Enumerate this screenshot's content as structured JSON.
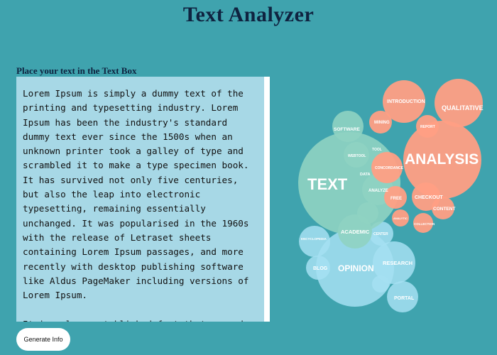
{
  "header": {
    "title": "Text Analyzer"
  },
  "input": {
    "label": "Place your text in the Text Box",
    "value": "Lorem Ipsum is simply a dummy text of the printing and typesetting industry. Lorem Ipsum has been the industry's standard dummy text ever since the 1500s when an unknown printer took a galley of type and scrambled it to make a type specimen book. It has survived not only five centuries, but also the leap into electronic typesetting, remaining essentially unchanged. It was popularised in the 1960s with the release of Letraset sheets containing Lorem Ipsum passages, and more recently with desktop publishing software like Aldus PageMaker including versions of Lorem Ipsum.\n\nIt is a long-established fact that a reader will be distracted by the readable content of a page when looking at its layout. The point of using Lorem Ipsum is that it has a more-or-less normal"
  },
  "actions": {
    "generate_label": "Generate Info"
  },
  "word_cloud": {
    "colors": {
      "green": "#8fd3c2",
      "orange": "#ff9f84",
      "blue": "#a6e0f2"
    },
    "words": {
      "text": "TEXT",
      "analysis": "ANALYSIS",
      "opinion": "OPINION",
      "qualitative": "QUALITATIVE",
      "introduction": "INTRODUCTION",
      "software": "SOFTWARE",
      "mining": "MINING",
      "tool": "TOOL",
      "concordance": "CONCORDANCE",
      "data": "DATA",
      "analyze": "ANALYZE",
      "academic": "ACADEMIC",
      "free": "FREE",
      "checkout": "CHECKOUT",
      "content": "CONTENT",
      "research": "RESEARCH",
      "blog": "BLOG",
      "portal": "PORTAL",
      "center": "CENTER",
      "encyclopedia": "ENCYCLOPEDIA",
      "collection": "COLLECTION",
      "analytic": "ANALYTIC",
      "report": "REPORT",
      "webtool": "WEBTOOL"
    }
  }
}
